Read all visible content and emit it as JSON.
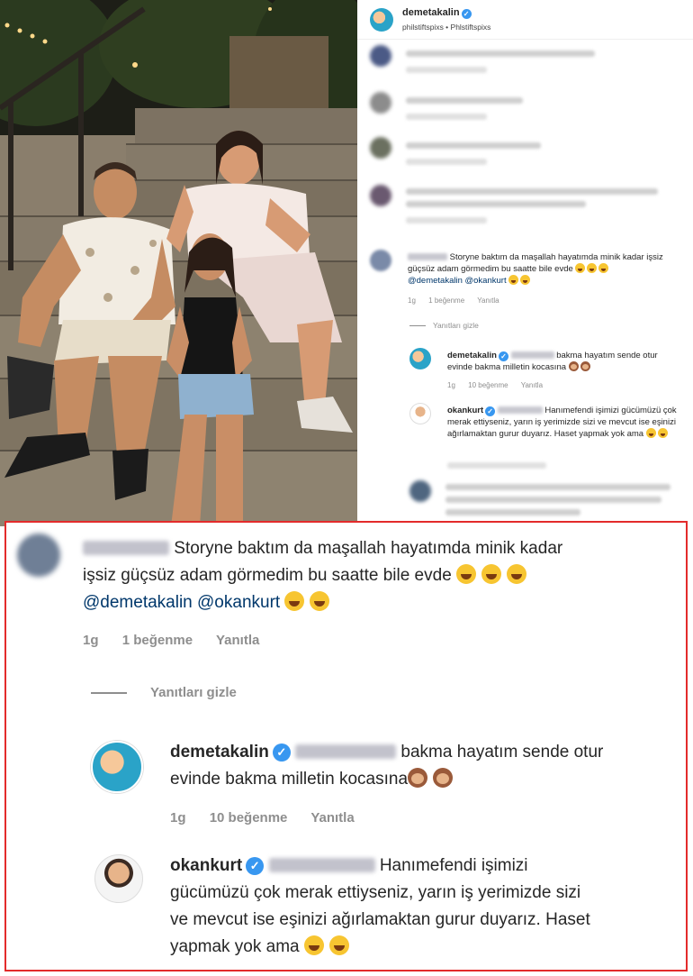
{
  "panel": {
    "header_user": "demetakalin",
    "header_sub": "philstiftspixs • Phlstiftspixs",
    "comment_text": "Storyne baktım da maşallah hayatımda minik kadar işsiz güçsüz adam görmedim bu saatte bile evde",
    "comment_mentions": "@demetakalin @okankurt",
    "comment_time": "1g",
    "comment_likes": "1 beğenme",
    "comment_reply": "Yanıtla",
    "hide_replies": "Yanıtları gizle",
    "reply1_user": "demetakalin",
    "reply1_text": "bakma hayatım sende otur evinde bakma milletin kocasına",
    "reply1_time": "1g",
    "reply1_likes": "10 beğenme",
    "reply1_reply": "Yanıtla",
    "reply2_user": "okankurt",
    "reply2_text": "Hanımefendi işimizi gücümüzü çok merak ettiyseniz, yarın iş yerimizde sizi ve mevcut ise eşinizi ağırlamaktan gurur duyarız. Haset yapmak yok ama"
  },
  "zoom": {
    "comment_text_line1": "Storyne baktım da maşallah hayatımda minik kadar",
    "comment_text_line2": "işsiz güçsüz adam görmedim bu saatte bile evde",
    "comment_mentions": "@demetakalin @okankurt",
    "comment_time": "1g",
    "comment_likes": "1 beğenme",
    "comment_reply": "Yanıtla",
    "hide_replies": "Yanıtları gizle",
    "reply1_user": "demetakalin",
    "reply1_text_line1": "bakma hayatım sende otur",
    "reply1_text_line2": "evinde bakma milletin kocasına",
    "reply1_time": "1g",
    "reply1_likes": "10 beğenme",
    "reply1_reply": "Yanıtla",
    "reply2_user": "okankurt",
    "reply2_text_line1": "Hanımefendi işimizi",
    "reply2_text_line2": "gücümüzü çok merak ettiyseniz, yarın iş yerimizde sizi",
    "reply2_text_line3": "ve mevcut ise eşinizi ağırlamaktan gurur duyarız. Haset",
    "reply2_text_line4": "yapmak yok ama"
  },
  "colors": {
    "highlight_border": "#e32b2b",
    "verified": "#3897f0",
    "mention": "#00376b",
    "meta": "#8e8e8e"
  }
}
